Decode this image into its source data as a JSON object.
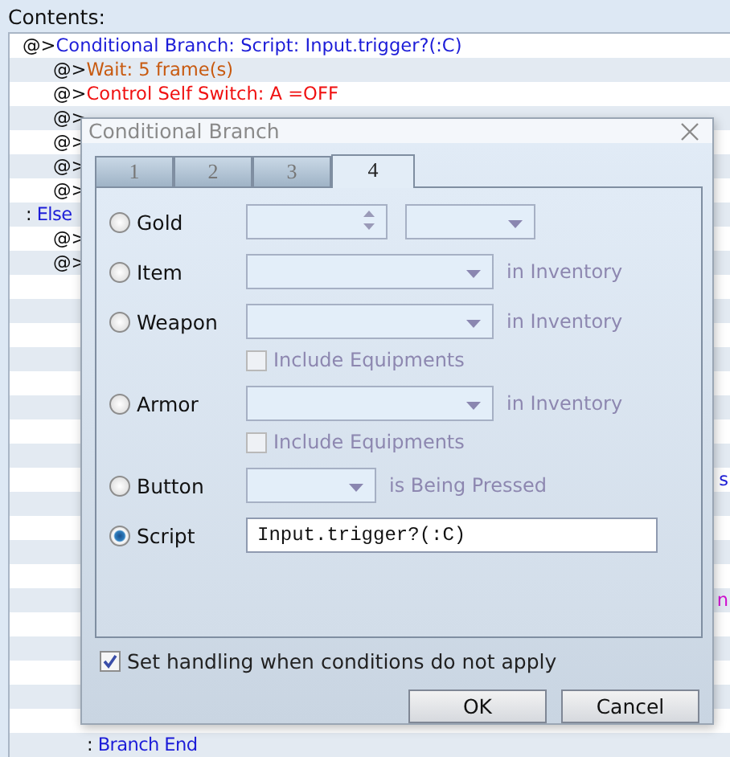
{
  "contents_label": "Contents:",
  "event_list": [
    {
      "kind": "command",
      "marker": "@>",
      "text": "Conditional Branch: Script: Input.trigger?(:C)",
      "color": "#1c1cd8",
      "children": [
        {
          "kind": "command",
          "marker": "@>",
          "text": "Wait: 5 frame(s)",
          "color": "#c85a10"
        },
        {
          "kind": "command",
          "marker": "@>",
          "text": "Control Self Switch: A =OFF",
          "color": "#f01010"
        },
        {
          "kind": "command",
          "marker": "@>"
        },
        {
          "kind": "command",
          "marker": "@>"
        },
        {
          "kind": "command",
          "marker": "@>"
        },
        {
          "kind": "command",
          "marker": "@>"
        }
      ]
    },
    {
      "kind": "command",
      "marker": ":",
      "text": "Else",
      "color": "#1c1cd8",
      "children": [
        {
          "kind": "command",
          "marker": "@>"
        },
        {
          "kind": "command",
          "marker": "@>",
          "children": [
            {
              "kind": "covered"
            },
            {
              "kind": "covered"
            },
            {
              "kind": "covered"
            },
            {
              "kind": "covered"
            },
            {
              "kind": "covered"
            },
            {
              "kind": "covered"
            },
            {
              "kind": "covered"
            },
            {
              "kind": "covered"
            },
            {
              "kind": "tail",
              "text": "s",
              "color": "#1c1cd8"
            },
            {
              "kind": "covered"
            },
            {
              "kind": "covered"
            },
            {
              "kind": "covered"
            },
            {
              "kind": "covered"
            },
            {
              "kind": "tail",
              "text": "n",
              "color": "#d010d0"
            },
            {
              "kind": "covered"
            },
            {
              "kind": "covered"
            },
            {
              "kind": "covered"
            },
            {
              "kind": "covered"
            },
            {
              "kind": "covered"
            },
            {
              "kind": "command",
              "marker": ":",
              "text": "Branch End",
              "color": "#1c1cd8"
            }
          ]
        }
      ]
    }
  ],
  "dialog": {
    "title": "Conditional Branch",
    "tabs": [
      {
        "label": "1",
        "selected": false
      },
      {
        "label": "2",
        "selected": false
      },
      {
        "label": "3",
        "selected": false
      },
      {
        "label": "4",
        "selected": true
      }
    ],
    "conditions": [
      {
        "kind": "gold",
        "label": "Gold",
        "selected": false
      },
      {
        "kind": "select",
        "label": "Item",
        "selected": false,
        "suffix": "in Inventory"
      },
      {
        "kind": "select",
        "label": "Weapon",
        "selected": false,
        "suffix": "in Inventory",
        "include": {
          "label": "Include Equipments",
          "checked": false
        }
      },
      {
        "kind": "select",
        "label": "Armor",
        "selected": false,
        "suffix": "in Inventory",
        "include": {
          "label": "Include Equipments",
          "checked": false
        }
      },
      {
        "kind": "short_select",
        "label": "Button",
        "selected": false,
        "suffix": "is Being Pressed"
      },
      {
        "kind": "script",
        "label": "Script",
        "selected": true,
        "value": "Input.trigger?(:C)"
      }
    ],
    "else_option": {
      "label": "Set handling when conditions do not apply",
      "checked": true
    },
    "buttons": [
      "OK",
      "Cancel"
    ]
  }
}
